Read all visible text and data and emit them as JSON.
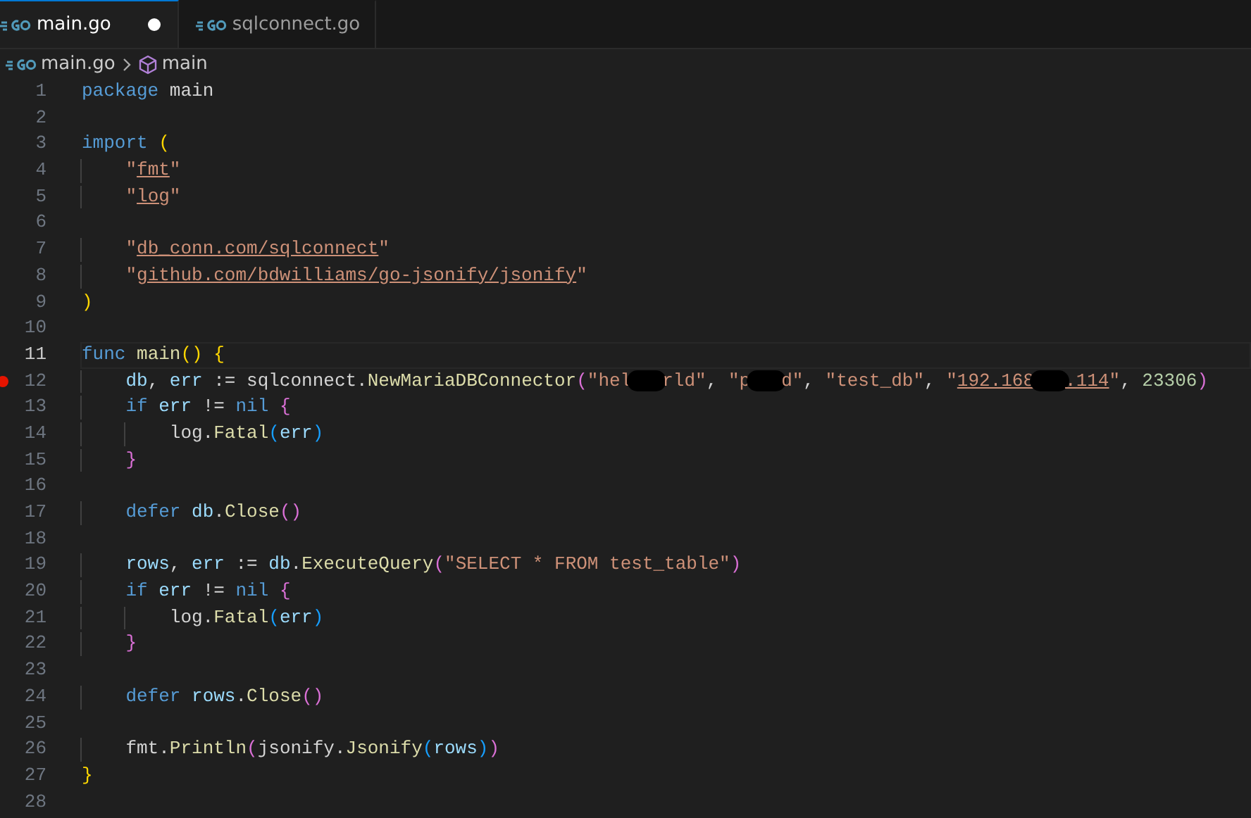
{
  "tabs": [
    {
      "label": "main.go",
      "selected": true,
      "modified": true
    },
    {
      "label": "sqlconnect.go",
      "selected": false,
      "modified": false
    }
  ],
  "breadcrumb": [
    {
      "label": "main.go",
      "kind": "file"
    },
    {
      "label": "main",
      "kind": "module"
    }
  ],
  "lines": [
    {
      "number": "1",
      "current": false,
      "breakpoint": false,
      "tokens": [
        {
          "kind": "keyword",
          "t": "package"
        },
        {
          "kind": "plain",
          "t": " main"
        }
      ]
    },
    {
      "number": "2",
      "current": false,
      "breakpoint": false
    },
    {
      "number": "3",
      "current": false,
      "breakpoint": false,
      "tokens": [
        {
          "kind": "keyword",
          "t": "import "
        },
        {
          "kind": "bracket1",
          "t": "("
        }
      ]
    },
    {
      "number": "4",
      "current": false,
      "breakpoint": false,
      "tokens": [
        {
          "kind": "indent"
        },
        {
          "kind": "string",
          "t": "\""
        },
        {
          "kind": "link",
          "t": "fmt"
        },
        {
          "kind": "string",
          "t": "\""
        }
      ]
    },
    {
      "number": "5",
      "current": false,
      "breakpoint": false,
      "tokens": [
        {
          "kind": "indent"
        },
        {
          "kind": "string",
          "t": "\""
        },
        {
          "kind": "link",
          "t": "log"
        },
        {
          "kind": "string",
          "t": "\""
        }
      ]
    },
    {
      "number": "6",
      "current": false,
      "breakpoint": false
    },
    {
      "number": "7",
      "current": false,
      "breakpoint": false,
      "tokens": [
        {
          "kind": "indent"
        },
        {
          "kind": "string",
          "t": "\""
        },
        {
          "kind": "link",
          "t": "db_conn.com/sqlconnect"
        },
        {
          "kind": "string",
          "t": "\""
        }
      ]
    },
    {
      "number": "8",
      "current": false,
      "breakpoint": false,
      "tokens": [
        {
          "kind": "indent"
        },
        {
          "kind": "string",
          "t": "\""
        },
        {
          "kind": "link",
          "t": "github.com/bdwilliams/go-jsonify/jsonify"
        },
        {
          "kind": "string",
          "t": "\""
        }
      ]
    },
    {
      "number": "9",
      "current": false,
      "breakpoint": false,
      "tokens": [
        {
          "kind": "bracket1",
          "t": ")"
        }
      ]
    },
    {
      "number": "10",
      "current": false,
      "breakpoint": false
    },
    {
      "number": "11",
      "current": true,
      "breakpoint": false,
      "tokens": [
        {
          "kind": "keyword",
          "t": "func "
        },
        {
          "kind": "function",
          "t": "main"
        },
        {
          "kind": "bracket1",
          "t": "() {"
        }
      ]
    },
    {
      "number": "12",
      "current": false,
      "breakpoint": true,
      "tokens": [
        {
          "kind": "indent"
        },
        {
          "kind": "variable",
          "t": "db"
        },
        {
          "kind": "plain",
          "t": ", "
        },
        {
          "kind": "variable",
          "t": "err"
        },
        {
          "kind": "plain",
          "t": " := sqlconnect."
        },
        {
          "kind": "function",
          "t": "NewMariaDBConnector"
        },
        {
          "kind": "bracket2",
          "t": "("
        },
        {
          "kind": "string",
          "t": "\"hel"
        },
        {
          "kind": "redaction"
        },
        {
          "kind": "string",
          "t": "rld\""
        },
        {
          "kind": "plain",
          "t": ", "
        },
        {
          "kind": "string",
          "t": "\"p"
        },
        {
          "kind": "redaction"
        },
        {
          "kind": "string",
          "t": "d\""
        },
        {
          "kind": "plain",
          "t": ", "
        },
        {
          "kind": "string",
          "t": "\"test_db\""
        },
        {
          "kind": "plain",
          "t": ", "
        },
        {
          "kind": "string",
          "t": "\""
        },
        {
          "kind": "link",
          "t": "192.168"
        },
        {
          "kind": "redaction"
        },
        {
          "kind": "link",
          "t": ".114"
        },
        {
          "kind": "string",
          "t": "\""
        },
        {
          "kind": "plain",
          "t": ", "
        },
        {
          "kind": "number",
          "t": "23306"
        },
        {
          "kind": "bracket2",
          "t": ")"
        }
      ]
    },
    {
      "number": "13",
      "current": false,
      "breakpoint": false,
      "tokens": [
        {
          "kind": "indent"
        },
        {
          "kind": "keyword",
          "t": "if "
        },
        {
          "kind": "variable",
          "t": "err"
        },
        {
          "kind": "plain",
          "t": " != "
        },
        {
          "kind": "keyword",
          "t": "nil "
        },
        {
          "kind": "bracket2",
          "t": "{"
        }
      ]
    },
    {
      "number": "14",
      "current": false,
      "breakpoint": false,
      "tokens": [
        {
          "kind": "indent"
        },
        {
          "kind": "indent"
        },
        {
          "kind": "plain",
          "t": "log."
        },
        {
          "kind": "function",
          "t": "Fatal"
        },
        {
          "kind": "bracket3",
          "t": "("
        },
        {
          "kind": "variable",
          "t": "err"
        },
        {
          "kind": "bracket3",
          "t": ")"
        }
      ]
    },
    {
      "number": "15",
      "current": false,
      "breakpoint": false,
      "tokens": [
        {
          "kind": "indent"
        },
        {
          "kind": "bracket2",
          "t": "}"
        }
      ]
    },
    {
      "number": "16",
      "current": false,
      "breakpoint": false
    },
    {
      "number": "17",
      "current": false,
      "breakpoint": false,
      "tokens": [
        {
          "kind": "indent"
        },
        {
          "kind": "keyword",
          "t": "defer "
        },
        {
          "kind": "variable",
          "t": "db"
        },
        {
          "kind": "plain",
          "t": "."
        },
        {
          "kind": "function",
          "t": "Close"
        },
        {
          "kind": "bracket2",
          "t": "()"
        }
      ]
    },
    {
      "number": "18",
      "current": false,
      "breakpoint": false
    },
    {
      "number": "19",
      "current": false,
      "breakpoint": false,
      "tokens": [
        {
          "kind": "indent"
        },
        {
          "kind": "variable",
          "t": "rows"
        },
        {
          "kind": "plain",
          "t": ", "
        },
        {
          "kind": "variable",
          "t": "err"
        },
        {
          "kind": "plain",
          "t": " := "
        },
        {
          "kind": "variable",
          "t": "db"
        },
        {
          "kind": "plain",
          "t": "."
        },
        {
          "kind": "function",
          "t": "ExecuteQuery"
        },
        {
          "kind": "bracket2",
          "t": "("
        },
        {
          "kind": "string",
          "t": "\"SELECT * FROM test_table\""
        },
        {
          "kind": "bracket2",
          "t": ")"
        }
      ]
    },
    {
      "number": "20",
      "current": false,
      "breakpoint": false,
      "tokens": [
        {
          "kind": "indent"
        },
        {
          "kind": "keyword",
          "t": "if "
        },
        {
          "kind": "variable",
          "t": "err"
        },
        {
          "kind": "plain",
          "t": " != "
        },
        {
          "kind": "keyword",
          "t": "nil "
        },
        {
          "kind": "bracket2",
          "t": "{"
        }
      ]
    },
    {
      "number": "21",
      "current": false,
      "breakpoint": false,
      "tokens": [
        {
          "kind": "indent"
        },
        {
          "kind": "indent"
        },
        {
          "kind": "plain",
          "t": "log."
        },
        {
          "kind": "function",
          "t": "Fatal"
        },
        {
          "kind": "bracket3",
          "t": "("
        },
        {
          "kind": "variable",
          "t": "err"
        },
        {
          "kind": "bracket3",
          "t": ")"
        }
      ]
    },
    {
      "number": "22",
      "current": false,
      "breakpoint": false,
      "tokens": [
        {
          "kind": "indent"
        },
        {
          "kind": "bracket2",
          "t": "}"
        }
      ]
    },
    {
      "number": "23",
      "current": false,
      "breakpoint": false
    },
    {
      "number": "24",
      "current": false,
      "breakpoint": false,
      "tokens": [
        {
          "kind": "indent"
        },
        {
          "kind": "keyword",
          "t": "defer "
        },
        {
          "kind": "variable",
          "t": "rows"
        },
        {
          "kind": "plain",
          "t": "."
        },
        {
          "kind": "function",
          "t": "Close"
        },
        {
          "kind": "bracket2",
          "t": "()"
        }
      ]
    },
    {
      "number": "25",
      "current": false,
      "breakpoint": false
    },
    {
      "number": "26",
      "current": false,
      "breakpoint": false,
      "tokens": [
        {
          "kind": "indent"
        },
        {
          "kind": "plain",
          "t": "fmt."
        },
        {
          "kind": "function",
          "t": "Println"
        },
        {
          "kind": "bracket2",
          "t": "("
        },
        {
          "kind": "plain",
          "t": "jsonify."
        },
        {
          "kind": "function",
          "t": "Jsonify"
        },
        {
          "kind": "bracket3",
          "t": "("
        },
        {
          "kind": "variable",
          "t": "rows"
        },
        {
          "kind": "bracket3",
          "t": ")"
        },
        {
          "kind": "bracket2",
          "t": ")"
        }
      ]
    },
    {
      "number": "27",
      "current": false,
      "breakpoint": false,
      "tokens": [
        {
          "kind": "bracket1",
          "t": "}"
        }
      ]
    },
    {
      "number": "28",
      "current": false,
      "breakpoint": false
    }
  ]
}
